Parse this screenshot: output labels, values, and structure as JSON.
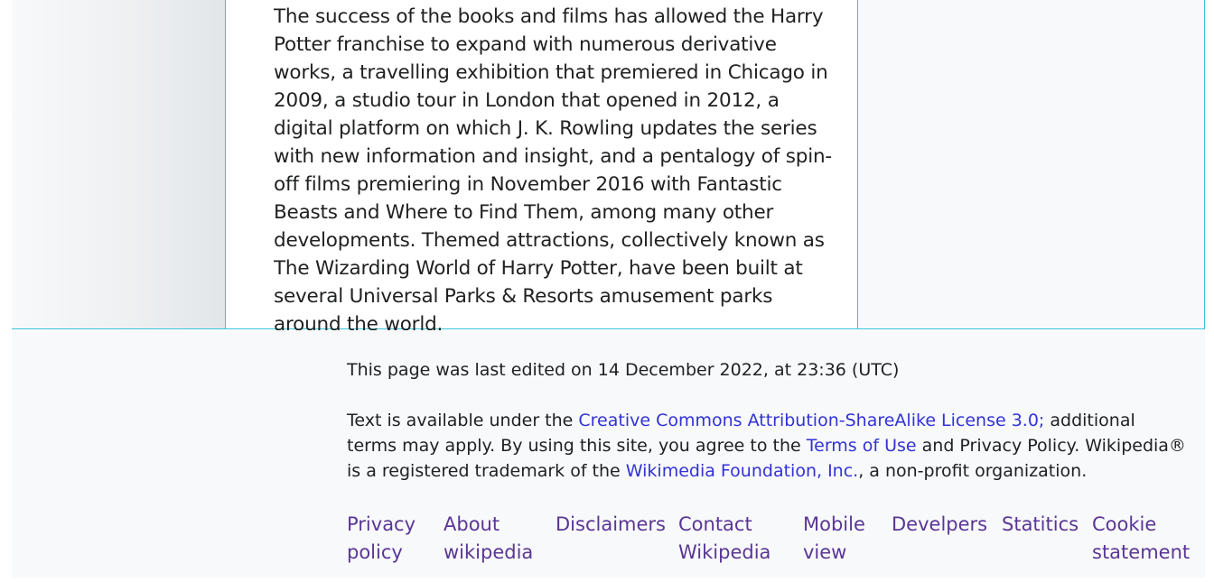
{
  "article": {
    "paragraph": "The success of the books and films has allowed the Harry Potter franchise to expand with numerous derivative works, a travelling exhibition that premiered in Chicago in 2009, a studio tour in London that opened in 2012, a digital platform on which J. K. Rowling updates the series with new information and insight, and a pentalogy of spin-off films premiering in November 2016 with Fantastic Beasts and Where to Find Them, among many other developments. Themed attractions, collectively known as The Wizarding World of Harry Potter, have been built at several Universal Parks & Resorts amusement parks around the world."
  },
  "footer": {
    "last_edited": "This page was last edited on 14 December 2022, at 23:36 (UTC)",
    "license": {
      "prefix": "Text is available under the ",
      "cc_link": "Creative Commons Attribution-ShareAlike License 3.0;",
      "middle1": " additional terms may apply. By using this site, you agree to the ",
      "terms_link": "Terms of Use",
      "middle2": " and Privacy Policy. Wikipedia® is a registered trademark of the ",
      "wmf_link": "Wikimedia Foundation, Inc.",
      "suffix": ", a non-profit organization."
    },
    "links": [
      {
        "line1": "Privacy",
        "line2": "policy"
      },
      {
        "line1": "About",
        "line2": "wikipedia"
      },
      {
        "line1": "Disclaimers",
        "line2": ""
      },
      {
        "line1": "Contact",
        "line2": "Wikipedia"
      },
      {
        "line1": "Mobile",
        "line2": "view"
      },
      {
        "line1": "Develpers",
        "line2": ""
      },
      {
        "line1": "Statitics",
        "line2": ""
      },
      {
        "line1": "Cookie",
        "line2": "statement"
      }
    ]
  },
  "colors": {
    "link": "#3232d6",
    "visited_link": "#5a3696",
    "border_accent": "#36c5d6",
    "text": "#202122"
  }
}
